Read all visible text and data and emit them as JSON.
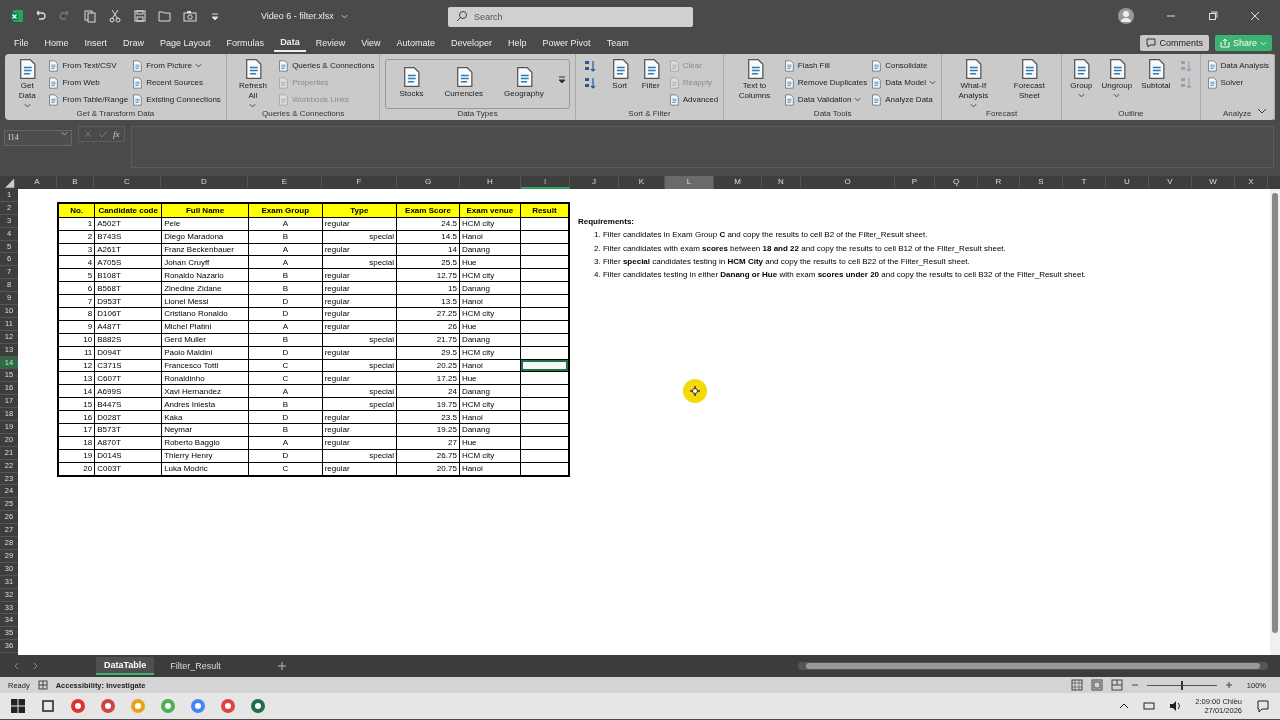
{
  "title_bar": {
    "file_name": "Video 6 - filter.xlsx",
    "search": {
      "placeholder": "Search"
    }
  },
  "menu_tabs": [
    {
      "label": "File",
      "selected": false
    },
    {
      "label": "Home",
      "selected": false
    },
    {
      "label": "Insert",
      "selected": false
    },
    {
      "label": "Draw",
      "selected": false
    },
    {
      "label": "Page Layout",
      "selected": false
    },
    {
      "label": "Formulas",
      "selected": false
    },
    {
      "label": "Data",
      "selected": true
    },
    {
      "label": "Review",
      "selected": false
    },
    {
      "label": "View",
      "selected": false
    },
    {
      "label": "Automate",
      "selected": false
    },
    {
      "label": "Developer",
      "selected": false
    },
    {
      "label": "Help",
      "selected": false
    },
    {
      "label": "Power Pivot",
      "selected": false
    },
    {
      "label": "Team",
      "selected": false
    }
  ],
  "comments_button": "Comments",
  "share_button": "Share",
  "ribbon_groups": [
    {
      "label": "Get & Transform Data",
      "kind": "standard",
      "items": [
        {
          "label": "Get Data",
          "kind": "large",
          "dropdown": true,
          "disabled": false
        },
        {
          "label": "From Text/CSV",
          "kind": "small",
          "dropdown": false,
          "disabled": false
        },
        {
          "label": "From Web",
          "kind": "small",
          "dropdown": false,
          "disabled": false
        },
        {
          "label": "From Table/Range",
          "kind": "small",
          "dropdown": false,
          "disabled": false
        },
        {
          "label": "From Picture",
          "kind": "small",
          "dropdown": true,
          "disabled": false
        },
        {
          "label": "Recent Sources",
          "kind": "small",
          "dropdown": false,
          "disabled": false
        },
        {
          "label": "Existing Connections",
          "kind": "small",
          "dropdown": false,
          "disabled": false
        }
      ]
    },
    {
      "label": "Queries & Connections",
      "kind": "standard",
      "items": [
        {
          "label": "Refresh All",
          "kind": "large",
          "dropdown": true,
          "disabled": false
        },
        {
          "label": "Queries & Connections",
          "kind": "small",
          "dropdown": false,
          "disabled": false
        },
        {
          "label": "Properties",
          "kind": "small",
          "dropdown": false,
          "disabled": true
        },
        {
          "label": "Workbook Links",
          "kind": "small",
          "dropdown": false,
          "disabled": true
        }
      ]
    },
    {
      "label": "Data Types",
      "kind": "gallery",
      "items": [
        {
          "label": "Stocks",
          "kind": "large",
          "dropdown": false,
          "disabled": false
        },
        {
          "label": "Currencies",
          "kind": "large",
          "dropdown": false,
          "disabled": false
        },
        {
          "label": "Geography",
          "kind": "large",
          "dropdown": false,
          "disabled": false
        }
      ]
    },
    {
      "label": "Sort & Filter",
      "kind": "standard",
      "items": [
        {
          "kind": "icon",
          "disabled": false
        },
        {
          "kind": "icon",
          "disabled": false
        },
        {
          "label": "Sort",
          "kind": "large",
          "dropdown": false,
          "disabled": false
        },
        {
          "label": "Filter",
          "kind": "large",
          "dropdown": false,
          "disabled": false
        },
        {
          "label": "Clear",
          "kind": "small",
          "dropdown": false,
          "disabled": true
        },
        {
          "label": "Reapply",
          "kind": "small",
          "dropdown": false,
          "disabled": true
        },
        {
          "label": "Advanced",
          "kind": "small",
          "dropdown": false,
          "disabled": false
        }
      ]
    },
    {
      "label": "Data Tools",
      "kind": "standard",
      "items": [
        {
          "label": "Text to Columns",
          "kind": "large",
          "dropdown": false,
          "disabled": false
        },
        {
          "label": "Flash Fill",
          "kind": "small",
          "dropdown": false,
          "disabled": false
        },
        {
          "label": "Remove Duplicates",
          "kind": "small",
          "dropdown": false,
          "disabled": false
        },
        {
          "label": "Data Validation",
          "kind": "small",
          "dropdown": true,
          "disabled": false
        },
        {
          "label": "Consolidate",
          "kind": "small",
          "dropdown": false,
          "disabled": false
        },
        {
          "label": "Data Model",
          "kind": "small",
          "dropdown": true,
          "disabled": false
        },
        {
          "label": "Analyze Data",
          "kind": "small",
          "dropdown": false,
          "disabled": false
        }
      ]
    },
    {
      "label": "Forecast",
      "kind": "standard",
      "items": [
        {
          "label": "What-If Analysis",
          "kind": "large",
          "dropdown": true,
          "disabled": false
        },
        {
          "label": "Forecast Sheet",
          "kind": "large",
          "dropdown": false,
          "disabled": false
        }
      ]
    },
    {
      "label": "Outline",
      "kind": "standard",
      "items": [
        {
          "label": "Group",
          "kind": "large",
          "dropdown": true,
          "disabled": false
        },
        {
          "label": "Ungroup",
          "kind": "large",
          "dropdown": true,
          "disabled": false
        },
        {
          "label": "Subtotal",
          "kind": "large",
          "dropdown": false,
          "disabled": false
        },
        {
          "kind": "icon",
          "disabled": true
        },
        {
          "kind": "icon",
          "disabled": true
        }
      ]
    },
    {
      "label": "Analyze",
      "kind": "standard",
      "items": [
        {
          "label": "Data Analysis",
          "kind": "small",
          "dropdown": false,
          "disabled": false
        },
        {
          "label": "Solver",
          "kind": "small",
          "dropdown": false,
          "disabled": false
        }
      ]
    }
  ],
  "formula_bar": {
    "name_box": "I14",
    "function_label": "fx"
  },
  "sheet_columns": [
    {
      "label": "A",
      "selected": false,
      "hovered": false
    },
    {
      "label": "B",
      "selected": false,
      "hovered": false
    },
    {
      "label": "C",
      "selected": false,
      "hovered": false
    },
    {
      "label": "D",
      "selected": false,
      "hovered": false
    },
    {
      "label": "E",
      "selected": false,
      "hovered": false
    },
    {
      "label": "F",
      "selected": false,
      "hovered": false
    },
    {
      "label": "G",
      "selected": false,
      "hovered": false
    },
    {
      "label": "H",
      "selected": false,
      "hovered": false
    },
    {
      "label": "I",
      "selected": true,
      "hovered": false
    },
    {
      "label": "J",
      "selected": false,
      "hovered": false
    },
    {
      "label": "K",
      "selected": false,
      "hovered": false
    },
    {
      "label": "L",
      "selected": false,
      "hovered": true
    },
    {
      "label": "M",
      "selected": false,
      "hovered": false
    },
    {
      "label": "N",
      "selected": false,
      "hovered": false
    },
    {
      "label": "O",
      "selected": false,
      "hovered": false
    },
    {
      "label": "P",
      "selected": false,
      "hovered": false
    },
    {
      "label": "Q",
      "selected": false,
      "hovered": false
    },
    {
      "label": "R",
      "selected": false,
      "hovered": false
    },
    {
      "label": "S",
      "selected": false,
      "hovered": false
    },
    {
      "label": "T",
      "selected": false,
      "hovered": false
    },
    {
      "label": "U",
      "selected": false,
      "hovered": false
    },
    {
      "label": "V",
      "selected": false,
      "hovered": false
    },
    {
      "label": "W",
      "selected": false,
      "hovered": false
    },
    {
      "label": "X",
      "selected": false,
      "hovered": false
    }
  ],
  "sheet_rows": [
    {
      "label": "1",
      "selected": false
    },
    {
      "label": "2",
      "selected": false
    },
    {
      "label": "3",
      "selected": false
    },
    {
      "label": "4",
      "selected": false
    },
    {
      "label": "5",
      "selected": false
    },
    {
      "label": "6",
      "selected": false
    },
    {
      "label": "7",
      "selected": false
    },
    {
      "label": "8",
      "selected": false
    },
    {
      "label": "9",
      "selected": false
    },
    {
      "label": "10",
      "selected": false
    },
    {
      "label": "11",
      "selected": false
    },
    {
      "label": "12",
      "selected": false
    },
    {
      "label": "13",
      "selected": false
    },
    {
      "label": "14",
      "selected": true
    },
    {
      "label": "15",
      "selected": false
    },
    {
      "label": "16",
      "selected": false
    },
    {
      "label": "17",
      "selected": false
    },
    {
      "label": "18",
      "selected": false
    },
    {
      "label": "19",
      "selected": false
    },
    {
      "label": "20",
      "selected": false
    },
    {
      "label": "21",
      "selected": false
    },
    {
      "label": "22",
      "selected": false
    },
    {
      "label": "23",
      "selected": false
    },
    {
      "label": "24",
      "selected": false
    },
    {
      "label": "25",
      "selected": false
    },
    {
      "label": "26",
      "selected": false
    },
    {
      "label": "27",
      "selected": false
    },
    {
      "label": "28",
      "selected": false
    },
    {
      "label": "29",
      "selected": false
    },
    {
      "label": "30",
      "selected": false
    },
    {
      "label": "31",
      "selected": false
    },
    {
      "label": "32",
      "selected": false
    },
    {
      "label": "33",
      "selected": false
    },
    {
      "label": "34",
      "selected": false
    },
    {
      "label": "35",
      "selected": false
    },
    {
      "label": "36",
      "selected": false
    }
  ],
  "table": {
    "columns": [
      "No.",
      "Candidate code",
      "Full Name",
      "Exam Group",
      "Type",
      "Exam Score",
      "Exam venue",
      "Result"
    ],
    "rows": [
      {
        "no": "1",
        "code": "A502T",
        "name": "Pele",
        "group": "A",
        "type": "regular",
        "kind": "regular",
        "score": "24.5",
        "venue": "HCM city",
        "result_selected": false
      },
      {
        "no": "2",
        "code": "B743S",
        "name": "Diego Maradona",
        "group": "B",
        "type": "special",
        "kind": "special",
        "score": "14.5",
        "venue": "Hanoi",
        "result_selected": false
      },
      {
        "no": "3",
        "code": "A261T",
        "name": "Franz Beckenbauer",
        "group": "A",
        "type": "regular",
        "kind": "regular",
        "score": "14",
        "venue": "Danang",
        "result_selected": false
      },
      {
        "no": "4",
        "code": "A705S",
        "name": "Johan Cruyff",
        "group": "A",
        "type": "special",
        "kind": "special",
        "score": "25.5",
        "venue": "Hue",
        "result_selected": false
      },
      {
        "no": "5",
        "code": "B108T",
        "name": "Ronaldo Nazario",
        "group": "B",
        "type": "regular",
        "kind": "regular",
        "score": "12.75",
        "venue": "HCM city",
        "result_selected": false
      },
      {
        "no": "6",
        "code": "B568T",
        "name": "Zinedine Zidane",
        "group": "B",
        "type": "regular",
        "kind": "regular",
        "score": "15",
        "venue": "Danang",
        "result_selected": false
      },
      {
        "no": "7",
        "code": "D953T",
        "name": "Lionel Messi",
        "group": "D",
        "type": "regular",
        "kind": "regular",
        "score": "13.5",
        "venue": "Hanoi",
        "result_selected": false
      },
      {
        "no": "8",
        "code": "D106T",
        "name": "Cristiano Ronaldo",
        "group": "D",
        "type": "regular",
        "kind": "regular",
        "score": "27.25",
        "venue": "HCM city",
        "result_selected": false
      },
      {
        "no": "9",
        "code": "A487T",
        "name": "Michel Platini",
        "group": "A",
        "type": "regular",
        "kind": "regular",
        "score": "26",
        "venue": "Hue",
        "result_selected": false
      },
      {
        "no": "10",
        "code": "B882S",
        "name": "Gerd Muller",
        "group": "B",
        "type": "special",
        "kind": "special",
        "score": "21.75",
        "venue": "Danang",
        "result_selected": false
      },
      {
        "no": "11",
        "code": "D094T",
        "name": "Paolo Maldini",
        "group": "D",
        "type": "regular",
        "kind": "regular",
        "score": "29.5",
        "venue": "HCM city",
        "result_selected": false
      },
      {
        "no": "12",
        "code": "C371S",
        "name": "Francesco Totti",
        "group": "C",
        "type": "special",
        "kind": "special",
        "score": "20.25",
        "venue": "Hanoi",
        "result_selected": true
      },
      {
        "no": "13",
        "code": "C607T",
        "name": "Ronaldinho",
        "group": "C",
        "type": "regular",
        "kind": "regular",
        "score": "17.25",
        "venue": "Hue",
        "result_selected": false
      },
      {
        "no": "14",
        "code": "A699S",
        "name": "Xavi Hernandez",
        "group": "A",
        "type": "special",
        "kind": "special",
        "score": "24",
        "venue": "Danang",
        "result_selected": false
      },
      {
        "no": "15",
        "code": "B447S",
        "name": "Andres Iniesta",
        "group": "B",
        "type": "special",
        "kind": "special",
        "score": "19.75",
        "venue": "HCM city",
        "result_selected": false
      },
      {
        "no": "16",
        "code": "D028T",
        "name": "Kaka",
        "group": "D",
        "type": "regular",
        "kind": "regular",
        "score": "23.5",
        "venue": "Hanoi",
        "result_selected": false
      },
      {
        "no": "17",
        "code": "B573T",
        "name": "Neymar",
        "group": "B",
        "type": "regular",
        "kind": "regular",
        "score": "19.25",
        "venue": "Danang",
        "result_selected": false
      },
      {
        "no": "18",
        "code": "A870T",
        "name": "Roberto Baggio",
        "group": "A",
        "type": "regular",
        "kind": "regular",
        "score": "27",
        "venue": "Hue",
        "result_selected": false
      },
      {
        "no": "19",
        "code": "D014S",
        "name": "Thierry Henry",
        "group": "D",
        "type": "special",
        "kind": "special",
        "score": "26.75",
        "venue": "HCM city",
        "result_selected": false
      },
      {
        "no": "20",
        "code": "C003T",
        "name": "Luka Modric",
        "group": "C",
        "type": "regular",
        "kind": "regular",
        "score": "20.75",
        "venue": "Hanoi",
        "result_selected": false
      }
    ]
  },
  "requirements": {
    "title": "Requirements:",
    "items": [
      "1. Filter candidates in Exam Group **C** and copy the results to cell B2 of the Filter_Result sheet.",
      "2. Filter candidates with exam **scores** between **18 and 22** and copy the results to cell B12 of the Filter_Result sheet.",
      "3. Filter **special** candidates testing in **HCM City** and copy the results to cell B22 of the Filter_Result sheet.",
      "4. Filter candidates testing in either **Danang or Hue** with exam **scores under 20** and copy the results to cell B32 of the Filter_Result sheet."
    ]
  },
  "sheet_tabs": [
    {
      "label": "DataTable",
      "selected": true
    },
    {
      "label": "Filter_Result",
      "selected": false
    }
  ],
  "status_bar": {
    "mode": "Ready",
    "accessibility": "Accessibility: Investigate",
    "zoom": {
      "level": 0.5,
      "reading": "100%"
    }
  },
  "taskbar": {
    "time": "2:09:00 Chiều",
    "date": "27/01/2026"
  }
}
